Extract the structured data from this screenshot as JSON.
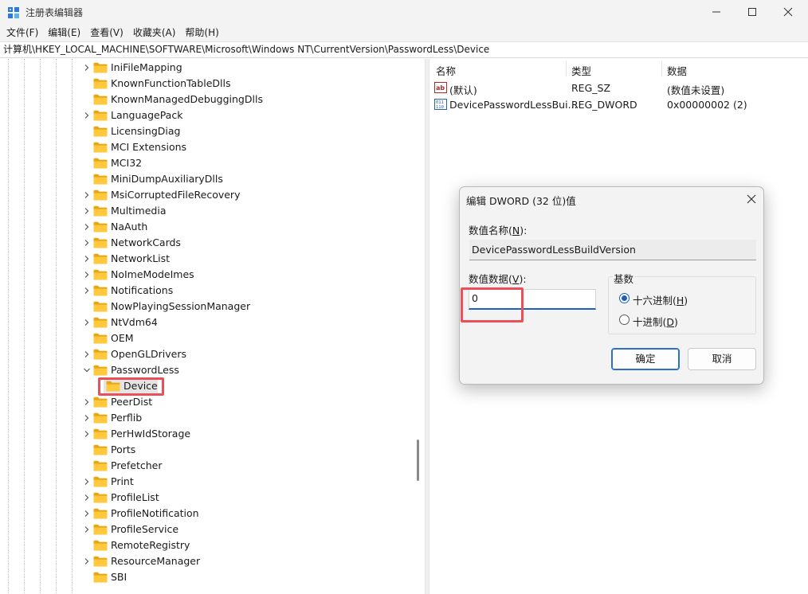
{
  "window": {
    "title": "注册表编辑器"
  },
  "menu": [
    "文件(F)",
    "编辑(E)",
    "查看(V)",
    "收藏夹(A)",
    "帮助(H)"
  ],
  "address": "计算机\\HKEY_LOCAL_MACHINE\\SOFTWARE\\Microsoft\\Windows NT\\CurrentVersion\\PasswordLess\\Device",
  "tree": [
    {
      "label": "IniFileMapping",
      "expand": "collapsed"
    },
    {
      "label": "KnownFunctionTableDlls",
      "expand": "none"
    },
    {
      "label": "KnownManagedDebuggingDlls",
      "expand": "none"
    },
    {
      "label": "LanguagePack",
      "expand": "collapsed"
    },
    {
      "label": "LicensingDiag",
      "expand": "none"
    },
    {
      "label": "MCI Extensions",
      "expand": "none"
    },
    {
      "label": "MCI32",
      "expand": "none"
    },
    {
      "label": "MiniDumpAuxiliaryDlls",
      "expand": "none"
    },
    {
      "label": "MsiCorruptedFileRecovery",
      "expand": "collapsed"
    },
    {
      "label": "Multimedia",
      "expand": "collapsed"
    },
    {
      "label": "NaAuth",
      "expand": "collapsed"
    },
    {
      "label": "NetworkCards",
      "expand": "collapsed"
    },
    {
      "label": "NetworkList",
      "expand": "collapsed"
    },
    {
      "label": "NoImeModeImes",
      "expand": "collapsed"
    },
    {
      "label": "Notifications",
      "expand": "collapsed"
    },
    {
      "label": "NowPlayingSessionManager",
      "expand": "none"
    },
    {
      "label": "NtVdm64",
      "expand": "collapsed"
    },
    {
      "label": "OEM",
      "expand": "none"
    },
    {
      "label": "OpenGLDrivers",
      "expand": "collapsed"
    },
    {
      "label": "PasswordLess",
      "expand": "expanded"
    },
    {
      "label": "Device",
      "expand": "none",
      "child": true,
      "selected": true
    },
    {
      "label": "PeerDist",
      "expand": "collapsed"
    },
    {
      "label": "Perflib",
      "expand": "collapsed"
    },
    {
      "label": "PerHwIdStorage",
      "expand": "collapsed"
    },
    {
      "label": "Ports",
      "expand": "none"
    },
    {
      "label": "Prefetcher",
      "expand": "none"
    },
    {
      "label": "Print",
      "expand": "collapsed"
    },
    {
      "label": "ProfileList",
      "expand": "collapsed"
    },
    {
      "label": "ProfileNotification",
      "expand": "collapsed"
    },
    {
      "label": "ProfileService",
      "expand": "collapsed"
    },
    {
      "label": "RemoteRegistry",
      "expand": "none"
    },
    {
      "label": "ResourceManager",
      "expand": "collapsed"
    },
    {
      "label": "SBI",
      "expand": "none"
    }
  ],
  "list": {
    "headers": {
      "name": "名称",
      "type": "类型",
      "data": "数据"
    },
    "rows": [
      {
        "name": "(默认)",
        "type": "REG_SZ",
        "data": "(数值未设置)",
        "icon": "string-value-icon"
      },
      {
        "name": "DevicePasswordLessBui...",
        "type": "REG_DWORD",
        "data": "0x00000002 (2)",
        "icon": "binary-value-icon"
      }
    ]
  },
  "dialog": {
    "title": "编辑 DWORD (32 位)值",
    "name_label": "数值名称(",
    "name_key": "N",
    "name_label_end": "):",
    "name_value": "DevicePasswordLessBuildVersion",
    "data_label": "数值数据(",
    "data_key": "V",
    "data_label_end": "):",
    "data_value": "0",
    "base_label": "基数",
    "hex_label": "十六进制(",
    "hex_key": "H",
    "hex_end": ")",
    "dec_label": "十进制(",
    "dec_key": "D",
    "dec_end": ")",
    "ok": "确定",
    "cancel": "取消"
  }
}
